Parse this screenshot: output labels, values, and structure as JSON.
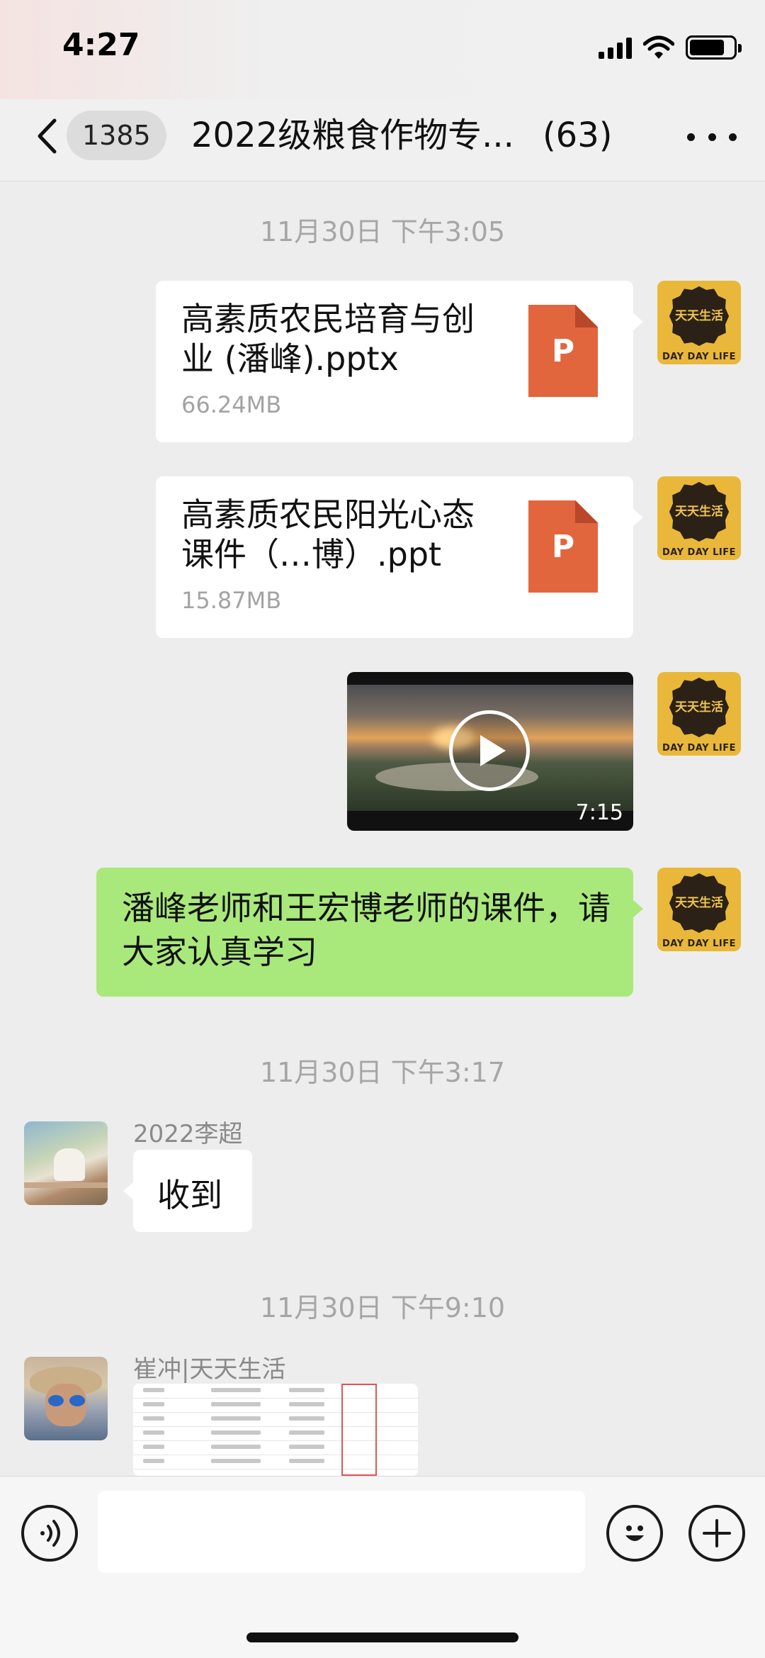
{
  "status_bar": {
    "time": "4:27"
  },
  "nav": {
    "unread_count": "1385",
    "title": "2022级粮食作物专...",
    "member_count": "(63)"
  },
  "messages": {
    "ts1": "11月30日 下午3:05",
    "file1": {
      "name": "高素质农民培育与创业 (潘峰).pptx",
      "size": "66.24MB",
      "type_letter": "P"
    },
    "file2": {
      "name": "高素质农民阳光心态课件（…博）.ppt",
      "size": "15.87MB",
      "type_letter": "P"
    },
    "video": {
      "duration": "7:15"
    },
    "text1": "潘峰老师和王宏博老师的课件，请大家认真学习",
    "ts2": "11月30日 下午3:17",
    "li_name": "2022李超",
    "li_text": "收到",
    "ts3": "11月30日 下午9:10",
    "cui_name": "崔冲|天天生活"
  },
  "avatar_ddl": {
    "seal_line1": "天天",
    "seal_line2": "生活",
    "label": "DAY DAY LIFE"
  },
  "colors": {
    "green_bubble": "#a9e97b",
    "ppt_orange": "#e2663d",
    "avatar_gold": "#e9b83a"
  }
}
